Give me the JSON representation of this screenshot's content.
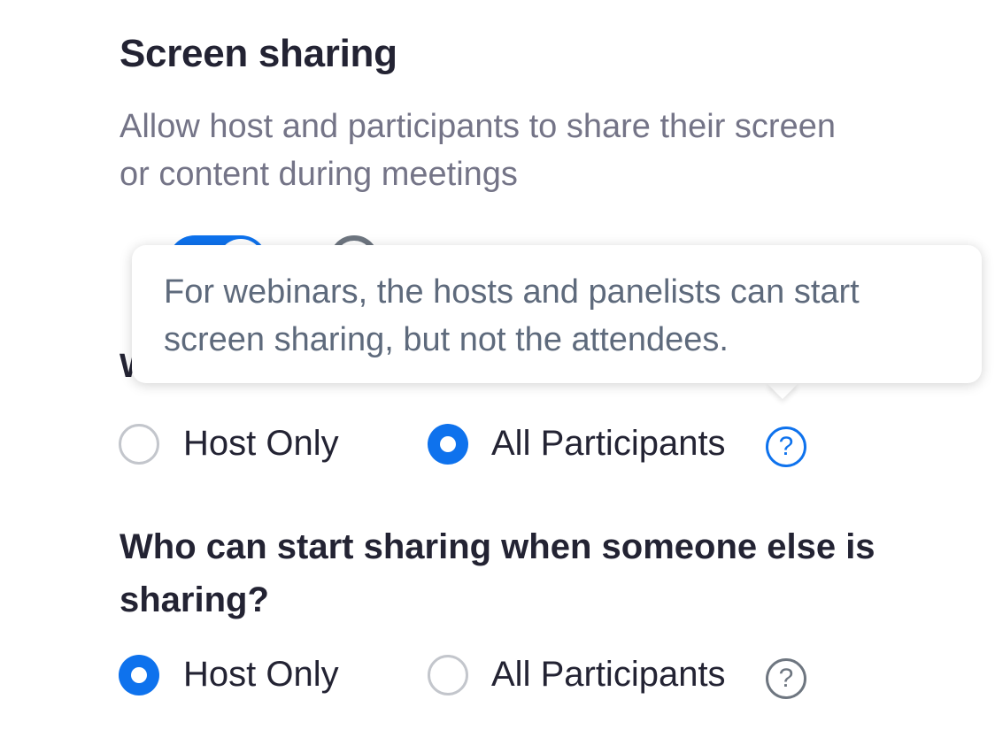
{
  "section": {
    "title": "Screen sharing",
    "description": "Allow host and participants to share their screen or content during meetings"
  },
  "tooltip": {
    "text": "For webinars, the hosts and panelists can start screen sharing, but not the attendees."
  },
  "hidden_question_initial": "W",
  "who_can_share": {
    "options": [
      {
        "label": "Host Only",
        "selected": false
      },
      {
        "label": "All Participants",
        "selected": true
      }
    ],
    "help_icon": "question-circle-icon"
  },
  "who_can_start_sharing": {
    "question": "Who can start sharing when someone else is sharing?",
    "options": [
      {
        "label": "Host Only",
        "selected": true
      },
      {
        "label": "All Participants",
        "selected": false
      }
    ],
    "help_icon": "question-circle-icon",
    "help_glyph": "?"
  },
  "colors": {
    "accent": "#0e72ed",
    "text_primary": "#232333",
    "text_secondary": "#747487",
    "icon_gray": "#6e7680"
  }
}
